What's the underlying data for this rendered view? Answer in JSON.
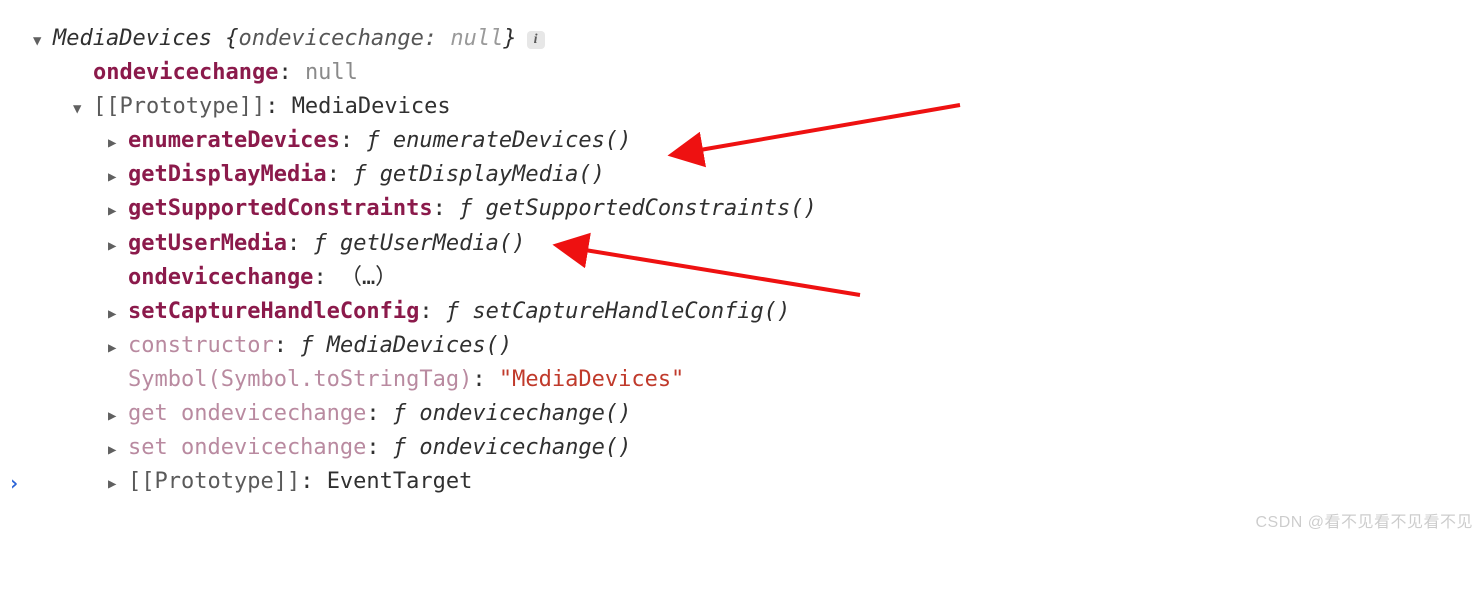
{
  "summary": {
    "className": "MediaDevices",
    "previewKey": "ondevicechange",
    "previewVal": "null"
  },
  "own": {
    "key": "ondevicechange",
    "val": "null"
  },
  "proto": {
    "label": "[[Prototype]]",
    "value": "MediaDevices",
    "entries": [
      {
        "kind": "func",
        "keyStyle": "own",
        "key": "enumerateDevices",
        "fn": "enumerateDevices()"
      },
      {
        "kind": "func",
        "keyStyle": "own",
        "key": "getDisplayMedia",
        "fn": "getDisplayMedia()"
      },
      {
        "kind": "func",
        "keyStyle": "own",
        "key": "getSupportedConstraints",
        "fn": "getSupportedConstraints()"
      },
      {
        "kind": "func",
        "keyStyle": "own",
        "key": "getUserMedia",
        "fn": "getUserMedia()"
      },
      {
        "kind": "plain",
        "keyStyle": "own",
        "key": "ondevicechange",
        "val": "（…）",
        "noArrow": true
      },
      {
        "kind": "func",
        "keyStyle": "own",
        "key": "setCaptureHandleConfig",
        "fn": "setCaptureHandleConfig()"
      },
      {
        "kind": "func",
        "keyStyle": "faded",
        "key": "constructor",
        "fn": "MediaDevices()"
      },
      {
        "kind": "string",
        "keyStyle": "faded",
        "key": "Symbol(Symbol.toStringTag)",
        "val": "\"MediaDevices\"",
        "noArrow": true
      },
      {
        "kind": "func",
        "keyStyle": "faded",
        "key": "get ondevicechange",
        "fn": "ondevicechange()"
      },
      {
        "kind": "func",
        "keyStyle": "faded",
        "key": "set ondevicechange",
        "fn": "ondevicechange()"
      },
      {
        "kind": "plain",
        "keyStyle": "internal",
        "key": "[[Prototype]]",
        "val": "EventTarget"
      }
    ]
  },
  "watermark": "CSDN @看不见看不见看不见"
}
